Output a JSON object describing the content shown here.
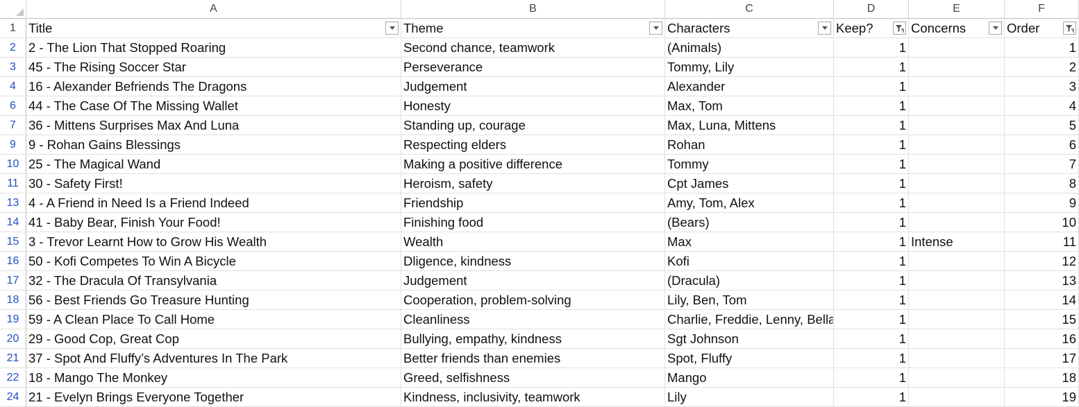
{
  "columns": [
    "A",
    "B",
    "C",
    "D",
    "E",
    "F"
  ],
  "header_row": {
    "row_number": "1",
    "cells": [
      {
        "text": "Title",
        "filter": "dropdown"
      },
      {
        "text": "Theme",
        "filter": "dropdown"
      },
      {
        "text": "Characters",
        "filter": "dropdown"
      },
      {
        "text": "Keep?",
        "filter": "filtered"
      },
      {
        "text": "Concerns",
        "filter": "dropdown"
      },
      {
        "text": "Order",
        "filter": "filtered"
      }
    ]
  },
  "rows": [
    {
      "row": "2",
      "title": "2 - The Lion That Stopped Roaring",
      "theme": "Second chance, teamwork",
      "characters": "(Animals)",
      "keep": "1",
      "concerns": "",
      "order": "1"
    },
    {
      "row": "3",
      "title": "45 - The Rising Soccer Star",
      "theme": "Perseverance",
      "characters": "Tommy, Lily",
      "keep": "1",
      "concerns": "",
      "order": "2"
    },
    {
      "row": "4",
      "title": "16 - Alexander Befriends The Dragons",
      "theme": "Judgement",
      "characters": "Alexander",
      "keep": "1",
      "concerns": "",
      "order": "3"
    },
    {
      "row": "6",
      "title": "44 - The Case Of The Missing Wallet",
      "theme": "Honesty",
      "characters": "Max, Tom",
      "keep": "1",
      "concerns": "",
      "order": "4"
    },
    {
      "row": "7",
      "title": "36 - Mittens Surprises Max And Luna",
      "theme": "Standing up, courage",
      "characters": "Max, Luna, Mittens",
      "keep": "1",
      "concerns": "",
      "order": "5"
    },
    {
      "row": "9",
      "title": "9 - Rohan Gains Blessings",
      "theme": "Respecting elders",
      "characters": "Rohan",
      "keep": "1",
      "concerns": "",
      "order": "6"
    },
    {
      "row": "10",
      "title": "25 - The Magical Wand",
      "theme": "Making a positive difference",
      "characters": "Tommy",
      "keep": "1",
      "concerns": "",
      "order": "7"
    },
    {
      "row": "11",
      "title": "30 - Safety First!",
      "theme": "Heroism, safety",
      "characters": "Cpt James",
      "keep": "1",
      "concerns": "",
      "order": "8"
    },
    {
      "row": "13",
      "title": "4 - A Friend in Need Is a Friend Indeed",
      "theme": "Friendship",
      "characters": "Amy, Tom, Alex",
      "keep": "1",
      "concerns": "",
      "order": "9"
    },
    {
      "row": "14",
      "title": "41 - Baby Bear, Finish Your Food!",
      "theme": "Finishing food",
      "characters": "(Bears)",
      "keep": "1",
      "concerns": "",
      "order": "10"
    },
    {
      "row": "15",
      "title": "3 - Trevor Learnt How to Grow His Wealth",
      "theme": "Wealth",
      "characters": "Max",
      "keep": "1",
      "concerns": "Intense",
      "order": "11"
    },
    {
      "row": "16",
      "title": "50 - Kofi Competes To Win A Bicycle",
      "theme": "Dligence, kindness",
      "characters": "Kofi",
      "keep": "1",
      "concerns": "",
      "order": "12"
    },
    {
      "row": "17",
      "title": "32 - The Dracula Of Transylvania",
      "theme": "Judgement",
      "characters": "(Dracula)",
      "keep": "1",
      "concerns": "",
      "order": "13"
    },
    {
      "row": "18",
      "title": "56 - Best Friends Go Treasure Hunting",
      "theme": "Cooperation, problem-solving",
      "characters": "Lily, Ben, Tom",
      "keep": "1",
      "concerns": "",
      "order": "14"
    },
    {
      "row": "19",
      "title": "59 - A Clean Place To Call Home",
      "theme": "Cleanliness",
      "characters": "Charlie, Freddie, Lenny, Bella",
      "keep": "1",
      "concerns": "",
      "order": "15"
    },
    {
      "row": "20",
      "title": "29 - Good Cop, Great Cop",
      "theme": "Bullying, empathy, kindness",
      "characters": "Sgt Johnson",
      "keep": "1",
      "concerns": "",
      "order": "16"
    },
    {
      "row": "21",
      "title": "37 - Spot And Fluffy’s Adventures In The Park",
      "theme": "Better friends than enemies",
      "characters": "Spot, Fluffy",
      "keep": "1",
      "concerns": "",
      "order": "17"
    },
    {
      "row": "22",
      "title": "18 - Mango The Monkey",
      "theme": "Greed, selfishness",
      "characters": "Mango",
      "keep": "1",
      "concerns": "",
      "order": "18"
    },
    {
      "row": "24",
      "title": "21 - Evelyn Brings Everyone Together",
      "theme": "Kindness, inclusivity, teamwork",
      "characters": "Lily",
      "keep": "1",
      "concerns": "",
      "order": "19"
    }
  ]
}
